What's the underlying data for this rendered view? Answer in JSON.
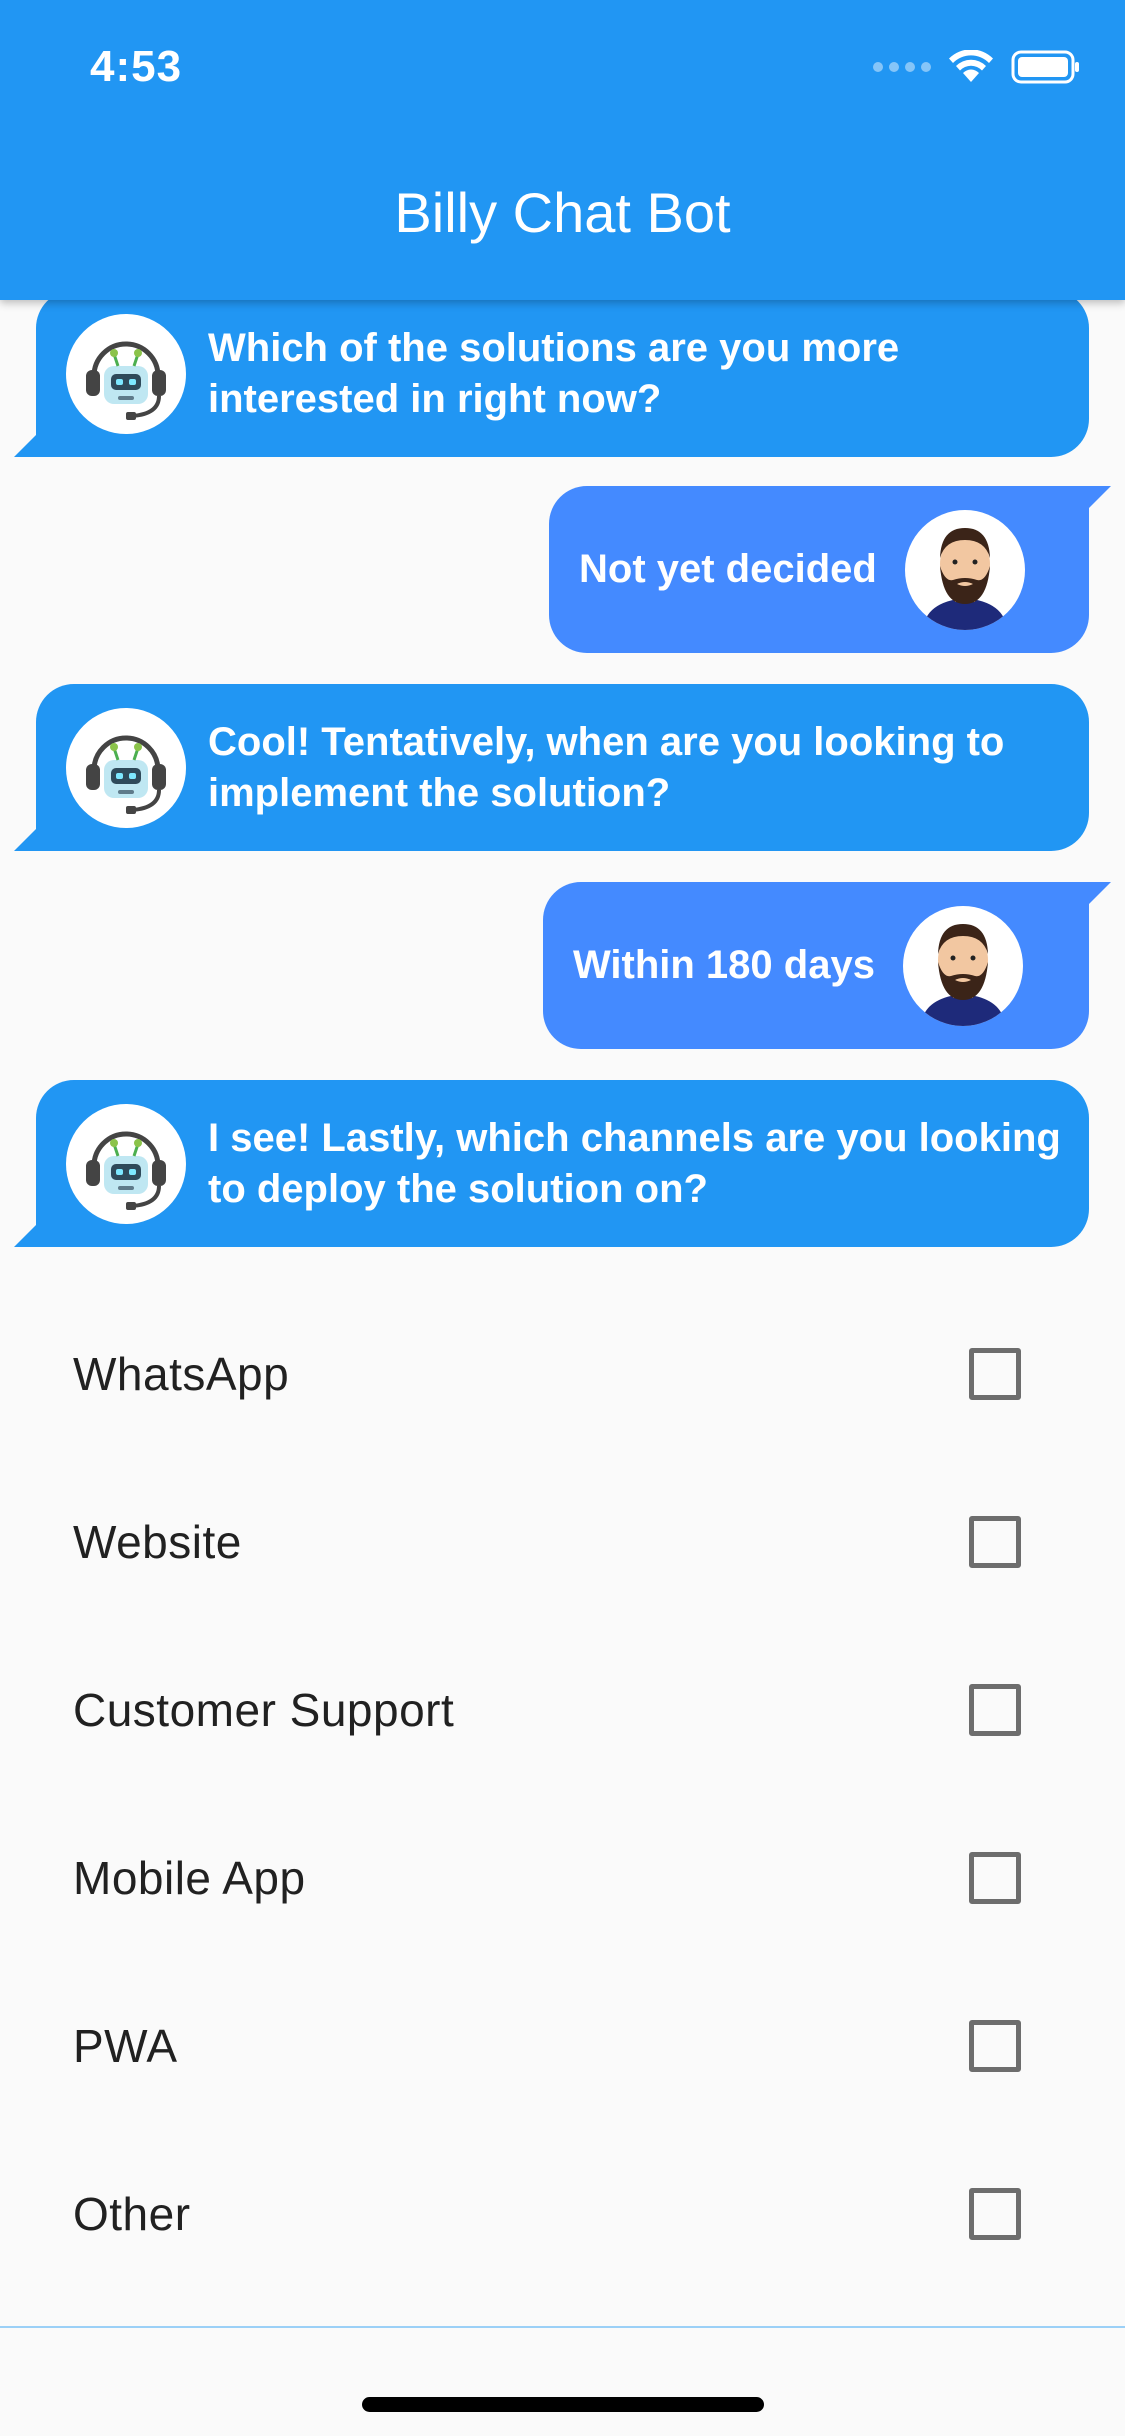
{
  "status_bar": {
    "time": "4:53"
  },
  "app_bar": {
    "title": "Billy Chat Bot"
  },
  "messages": [
    {
      "from": "bot",
      "text": "Which of the solutions are you more interested in right now?"
    },
    {
      "from": "user",
      "text": "Not yet decided"
    },
    {
      "from": "bot",
      "text": "Cool! Tentatively, when are you looking to implement the solution?"
    },
    {
      "from": "user",
      "text": "Within 180 days"
    },
    {
      "from": "bot",
      "text": "I see! Lastly, which channels are you looking to deploy the solution on?"
    }
  ],
  "options": [
    {
      "label": "WhatsApp",
      "checked": false
    },
    {
      "label": "Website",
      "checked": false
    },
    {
      "label": "Customer Support",
      "checked": false
    },
    {
      "label": "Mobile App",
      "checked": false
    },
    {
      "label": "PWA",
      "checked": false
    },
    {
      "label": "Other",
      "checked": false
    }
  ],
  "colors": {
    "app_bar": "#2196f3",
    "bot_bubble": "#2196f3",
    "user_bubble": "#448aff",
    "background": "#fafafa"
  },
  "icons": {
    "bot_avatar": "robot-headset-icon",
    "user_avatar": "bearded-man-avatar",
    "wifi": "wifi-icon",
    "battery": "battery-icon",
    "signal": "signal-dots-icon"
  }
}
